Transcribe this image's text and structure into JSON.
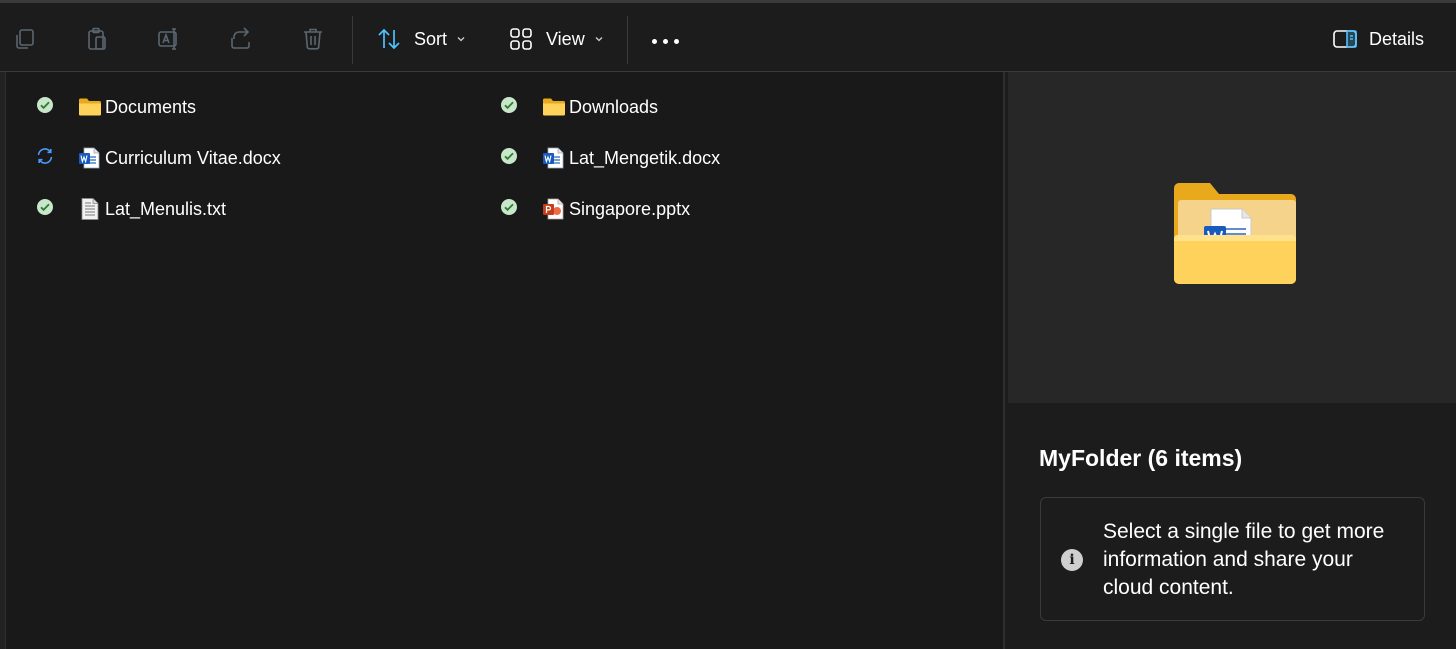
{
  "toolbar": {
    "icons": [
      "copy-icon",
      "paste-icon",
      "rename-icon",
      "share-icon",
      "delete-icon"
    ],
    "sort_label": "Sort",
    "view_label": "View",
    "details_label": "Details",
    "accent_color": "#4cc2ff"
  },
  "files": [
    {
      "name": "Documents",
      "type": "folder",
      "status": "synced"
    },
    {
      "name": "Downloads",
      "type": "folder",
      "status": "synced"
    },
    {
      "name": "Curriculum Vitae.docx",
      "type": "word",
      "status": "syncing"
    },
    {
      "name": "Lat_Mengetik.docx",
      "type": "word",
      "status": "synced"
    },
    {
      "name": "Lat_Menulis.txt",
      "type": "text",
      "status": "synced"
    },
    {
      "name": "Singapore.pptx",
      "type": "powerpoint",
      "status": "synced"
    }
  ],
  "details": {
    "title": "MyFolder (6 items)",
    "info_text": "Select a single file to get more information and share your cloud content."
  }
}
